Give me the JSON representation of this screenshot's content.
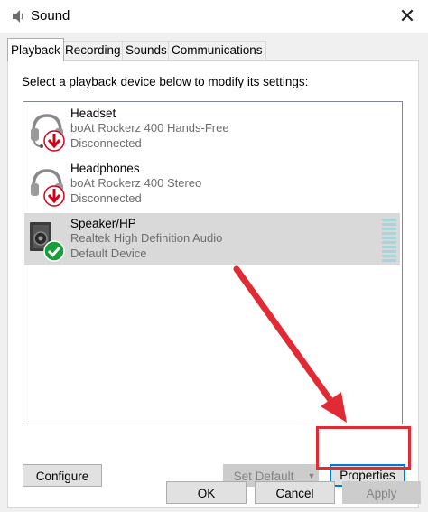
{
  "window": {
    "title": "Sound"
  },
  "tabs": [
    {
      "label": "Playback",
      "active": true
    },
    {
      "label": "Recording",
      "active": false
    },
    {
      "label": "Sounds",
      "active": false
    },
    {
      "label": "Communications",
      "active": false
    }
  ],
  "playback": {
    "instruction": "Select a playback device below to modify its settings:",
    "devices": [
      {
        "name": "Headset",
        "description": "boAt Rockerz 400 Hands-Free",
        "status": "Disconnected",
        "icon": "headset-disconnected-icon"
      },
      {
        "name": "Headphones",
        "description": "boAt Rockerz 400 Stereo",
        "status": "Disconnected",
        "icon": "headphones-disconnected-icon"
      },
      {
        "name": "Speaker/HP",
        "description": "Realtek High Definition Audio",
        "status": "Default Device",
        "icon": "speaker-default-icon",
        "selected": true
      }
    ],
    "buttons": {
      "configure": "Configure",
      "set_default": "Set Default",
      "properties": "Properties"
    }
  },
  "dialog_buttons": {
    "ok": "OK",
    "cancel": "Cancel",
    "apply": "Apply"
  },
  "colors": {
    "annotation_red": "#e02a34",
    "selection": "#d9d9d9",
    "focus_blue": "#0078d7",
    "check_green": "#1a9e3a",
    "disconnect_red": "#d0021b"
  }
}
